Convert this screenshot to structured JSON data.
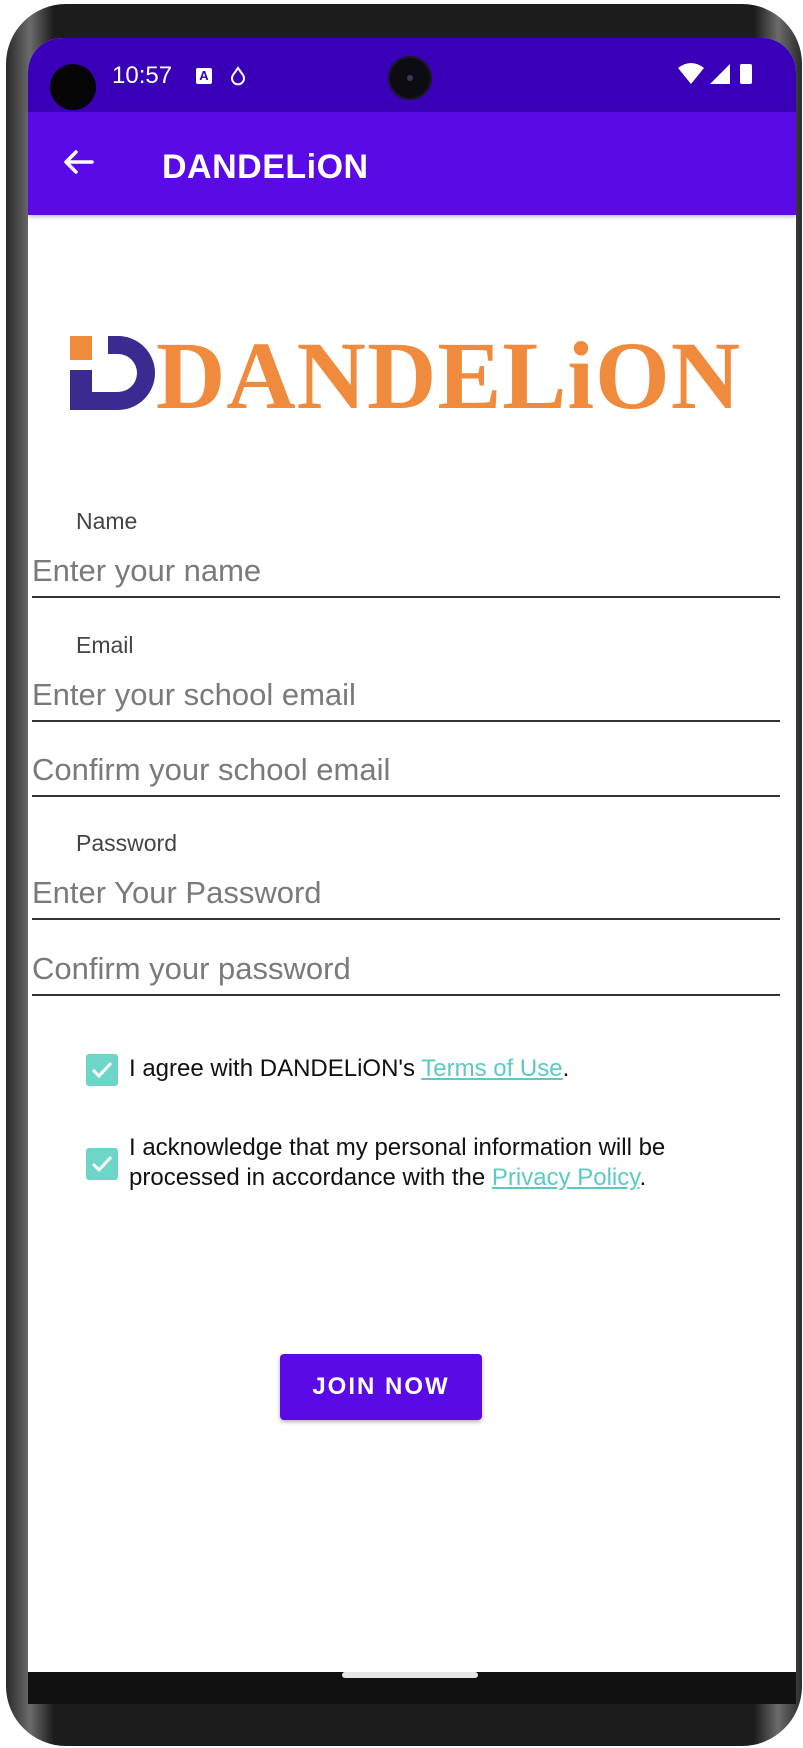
{
  "status_bar": {
    "time": "10:57",
    "icons": [
      "a-notification-icon",
      "data-saver-icon",
      "wifi-icon",
      "signal-icon",
      "battery-icon"
    ]
  },
  "app_bar": {
    "title": "DANDELiON",
    "back_icon": "arrow-back-icon"
  },
  "logo": {
    "text": "DANDELiON",
    "colors": {
      "mark": "#3b2a8f",
      "text": "#f08a3c"
    }
  },
  "form": {
    "name_label": "Name",
    "name_placeholder": "Enter your name",
    "email_label": "Email",
    "email_placeholder": "Enter your school email",
    "email_confirm_placeholder": "Confirm your school email",
    "password_label": "Password",
    "password_placeholder": "Enter Your Password",
    "password_confirm_placeholder": "Confirm your password"
  },
  "agreements": {
    "terms_prefix": "I agree with DANDELiON's ",
    "terms_link": "Terms of Use",
    "terms_suffix": ".",
    "terms_checked": true,
    "privacy_line1": "I acknowledge that my personal information will be",
    "privacy_line2_prefix": "processed in accordance with the ",
    "privacy_link": "Privacy Policy",
    "privacy_suffix": ".",
    "privacy_checked": true
  },
  "join_button": "JOIN NOW",
  "colors": {
    "primary": "#5a0ae6",
    "status_bar": "#3a00b8",
    "checkbox": "#6ed6c8",
    "link": "#5cc9c4"
  }
}
